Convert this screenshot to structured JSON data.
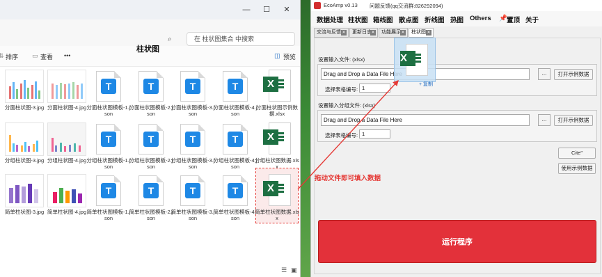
{
  "explorer": {
    "search_placeholder": "在 柱状图集合 中搜索",
    "toolbar": {
      "sort": "排序",
      "view": "查看",
      "more": "•••",
      "preview": "预览"
    },
    "files": [
      {
        "name": "分面柱状图-3.jpg",
        "kind": "image"
      },
      {
        "name": "分面柱状图-4.jpg",
        "kind": "image"
      },
      {
        "name": "分面柱状图模板-1.json",
        "kind": "json"
      },
      {
        "name": "分面柱状图模板-2.json",
        "kind": "json"
      },
      {
        "name": "分面柱状图模板-3.json",
        "kind": "json"
      },
      {
        "name": "分面柱状图模板-4.json",
        "kind": "json"
      },
      {
        "name": "分面柱状图示例数据.xlsx",
        "kind": "xlsx"
      },
      {
        "name": "分组柱状图-3.jpg",
        "kind": "image"
      },
      {
        "name": "分组柱状图-4.jpg",
        "kind": "image"
      },
      {
        "name": "分组柱状图模板-1.json",
        "kind": "json"
      },
      {
        "name": "分组柱状图模板-2.json",
        "kind": "json"
      },
      {
        "name": "分组柱状图模板-3.json",
        "kind": "json"
      },
      {
        "name": "分组柱状图模板-4.json",
        "kind": "json"
      },
      {
        "name": "分组柱状图数据.xlsx",
        "kind": "xlsx"
      },
      {
        "name": "简单柱状图-3.jpg",
        "kind": "image"
      },
      {
        "name": "简单柱状图-4.jpg",
        "kind": "image"
      },
      {
        "name": "简单柱状图模板-1.json",
        "kind": "json"
      },
      {
        "name": "简单柱状图模板-2.json",
        "kind": "json"
      },
      {
        "name": "简单柱状图模板-3.json",
        "kind": "json"
      },
      {
        "name": "简单柱状图模板-4.json",
        "kind": "json"
      },
      {
        "name": "简单柱状图数据.xlsx",
        "kind": "xlsx"
      }
    ]
  },
  "app": {
    "title": "EcoAmp v0.13",
    "feedback": "问题反馈(qq交流群:826292094)",
    "menu": [
      "数据处理",
      "柱状图",
      "箱线图",
      "散点图",
      "折线图",
      "热图",
      "Others",
      "置顶",
      "关于"
    ],
    "tabs": [
      "交流与反馈",
      "更新日志",
      "功能展示",
      "柱状图"
    ],
    "heading": "柱状图",
    "input1": {
      "label": "设置输入文件: (xlsx)",
      "value": "Drag and Drop a Data File Here",
      "browse": "...",
      "open_example": "打开示例数据",
      "sheet_label": "选择表格编号:",
      "sheet_value": "1"
    },
    "input2": {
      "label": "设置输入分组文件: (xlsx)",
      "value": "Drag and Drop a Data File Here",
      "browse": "...",
      "open_example": "打开示例数据",
      "sheet_label": "选择表格编号:",
      "sheet_value": "1"
    },
    "cite": "Cite\"",
    "use_example": "使用示例数据",
    "run": "运行程序"
  },
  "overlay": {
    "copy_hint": "+ 复制",
    "annotation": "拖动文件即可填入数据"
  },
  "colors": {
    "run_red": "#e3313a",
    "excel_green": "#1d6f42",
    "json_blue": "#1e88e5",
    "annotation_red": "#e53935"
  }
}
